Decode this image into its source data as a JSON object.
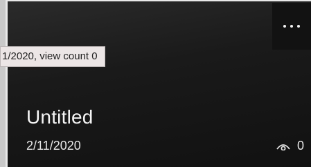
{
  "card": {
    "title": "Untitled",
    "date": "2/11/2020",
    "view_count": "0",
    "more_label": "More options"
  },
  "tooltip": {
    "text": "1/2020, view count 0"
  },
  "icons": {
    "more": "more-horizontal-icon",
    "views": "eye-icon"
  },
  "colors": {
    "card_bg": "#1a1a1a",
    "text": "#f4f4f4",
    "tooltip_bg": "#ece6e6"
  }
}
